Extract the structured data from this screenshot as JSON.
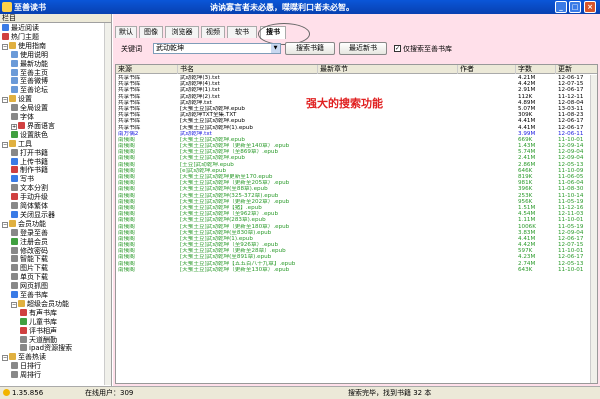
{
  "window": {
    "title": "至善读书",
    "banner": "讷讷寡言者未必愚，喋喋利口者未必智。"
  },
  "left": {
    "header": "栏目"
  },
  "tree": [
    {
      "label": "最近阅读",
      "depth": 0,
      "exp": "",
      "color": "#3a7be6"
    },
    {
      "label": "热门主题",
      "depth": 0,
      "exp": "",
      "color": "#d04040"
    },
    {
      "label": "使用指南",
      "depth": 0,
      "exp": "−",
      "color": "#e0b040"
    },
    {
      "label": "使用说明",
      "depth": 1,
      "exp": "",
      "color": "#6a9ad8"
    },
    {
      "label": "最新功能",
      "depth": 1,
      "exp": "",
      "color": "#6a9ad8"
    },
    {
      "label": "至善主页",
      "depth": 1,
      "exp": "",
      "color": "#6a9ad8"
    },
    {
      "label": "至善微博",
      "depth": 1,
      "exp": "",
      "color": "#6a9ad8"
    },
    {
      "label": "至善论坛",
      "depth": 1,
      "exp": "",
      "color": "#6a9ad8"
    },
    {
      "label": "设置",
      "depth": 0,
      "exp": "−",
      "color": "#e0b040"
    },
    {
      "label": "全局设置",
      "depth": 1,
      "exp": "",
      "color": "#888"
    },
    {
      "label": "字体",
      "depth": 1,
      "exp": "",
      "color": "#888"
    },
    {
      "label": "界面语言",
      "depth": 1,
      "exp": "+",
      "color": "#d04040"
    },
    {
      "label": "设置肤色",
      "depth": 1,
      "exp": "",
      "color": "#40a040"
    },
    {
      "label": "工具",
      "depth": 0,
      "exp": "−",
      "color": "#e0b040"
    },
    {
      "label": "打开书籍",
      "depth": 1,
      "exp": "",
      "color": "#888"
    },
    {
      "label": "上传书籍",
      "depth": 1,
      "exp": "",
      "color": "#3a7be6"
    },
    {
      "label": "制作书籍",
      "depth": 1,
      "exp": "",
      "color": "#d04040"
    },
    {
      "label": "写书",
      "depth": 1,
      "exp": "",
      "color": "#3a7be6"
    },
    {
      "label": "文本分割",
      "depth": 1,
      "exp": "",
      "color": "#888"
    },
    {
      "label": "手动升级",
      "depth": 1,
      "exp": "",
      "color": "#d04040"
    },
    {
      "label": "简体繁体",
      "depth": 1,
      "exp": "",
      "color": "#888"
    },
    {
      "label": "关闭显示器",
      "depth": 1,
      "exp": "",
      "color": "#3a7be6"
    },
    {
      "label": "会员功能",
      "depth": 0,
      "exp": "−",
      "color": "#e0b040"
    },
    {
      "label": "登录至善",
      "depth": 1,
      "exp": "",
      "color": "#888"
    },
    {
      "label": "注册会员",
      "depth": 1,
      "exp": "",
      "color": "#40a040"
    },
    {
      "label": "修改密码",
      "depth": 1,
      "exp": "",
      "color": "#888"
    },
    {
      "label": "智能下载",
      "depth": 1,
      "exp": "",
      "color": "#888"
    },
    {
      "label": "图片下载",
      "depth": 1,
      "exp": "",
      "color": "#888"
    },
    {
      "label": "单页下载",
      "depth": 1,
      "exp": "",
      "color": "#888"
    },
    {
      "label": "网页抓图",
      "depth": 1,
      "exp": "",
      "color": "#888"
    },
    {
      "label": "至善书库",
      "depth": 1,
      "exp": "",
      "color": "#3a7be6"
    },
    {
      "label": "超级会员功能",
      "depth": 1,
      "exp": "−",
      "color": "#e0b040"
    },
    {
      "label": "有声书库",
      "depth": 2,
      "exp": "",
      "color": "#d04040"
    },
    {
      "label": "儿童书库",
      "depth": 2,
      "exp": "",
      "color": "#40a040"
    },
    {
      "label": "评书相声",
      "depth": 2,
      "exp": "",
      "color": "#d04040"
    },
    {
      "label": "天道酬勤",
      "depth": 2,
      "exp": "",
      "color": "#888"
    },
    {
      "label": "ipad资源搜索",
      "depth": 2,
      "exp": "",
      "color": "#888"
    },
    {
      "label": "至善热读",
      "depth": 0,
      "exp": "−",
      "color": "#e0b040"
    },
    {
      "label": "日排行",
      "depth": 1,
      "exp": "",
      "color": "#888"
    },
    {
      "label": "周排行",
      "depth": 1,
      "exp": "",
      "color": "#888"
    }
  ],
  "tabs": [
    "默认",
    "图像",
    "浏览器",
    "视频",
    "软书",
    "搜书"
  ],
  "search": {
    "label": "关键词",
    "value": "武动乾坤",
    "btn_search": "搜索书籍",
    "btn_latest": "最近新书",
    "checkbox_label": "仅搜索至善书库",
    "checkbox_mark": "✓"
  },
  "annotation": "强大的搜索功能",
  "table": {
    "headers": [
      "来源",
      "书名",
      "最新章节",
      "作者",
      "字数",
      "更新"
    ],
    "rows": [
      {
        "src": "共享书库",
        "name": "武动乾坤(3).txt",
        "ch": "",
        "au": "",
        "size": "4.21M",
        "date": "12-06-17",
        "color": "#000"
      },
      {
        "src": "共享书库",
        "name": "武动乾坤(4).txt",
        "ch": "",
        "au": "",
        "size": "4.42M",
        "date": "12-07-15",
        "color": "#000"
      },
      {
        "src": "共享书库",
        "name": "武动乾坤(1).txt",
        "ch": "",
        "au": "",
        "size": "2.91M",
        "date": "12-06-17",
        "color": "#000"
      },
      {
        "src": "共享书库",
        "name": "武动乾坤(2).txt",
        "ch": "",
        "au": "",
        "size": "112K",
        "date": "11-12-11",
        "color": "#000"
      },
      {
        "src": "共享书库",
        "name": "武动乾坤.txt",
        "ch": "",
        "au": "",
        "size": "4.89M",
        "date": "12-08-04",
        "color": "#000"
      },
      {
        "src": "共享书库",
        "name": "[天蚕土豆]武动乾坤.epub",
        "ch": "",
        "au": "",
        "size": "5.07M",
        "date": "13-03-11",
        "color": "#000"
      },
      {
        "src": "共享书库",
        "name": "武动乾坤TXT全集.TXT",
        "ch": "",
        "au": "",
        "size": "309K",
        "date": "11-08-23",
        "color": "#000"
      },
      {
        "src": "共享书库",
        "name": "[天蚕土豆]武动乾坤.epub",
        "ch": "",
        "au": "",
        "size": "4.41M",
        "date": "12-06-17",
        "color": "#000"
      },
      {
        "src": "共享书库",
        "name": "[天蚕土豆]武动乾坤(1).epub",
        "ch": "",
        "au": "",
        "size": "4.41M",
        "date": "12-06-17",
        "color": "#000"
      },
      {
        "src": "南方偶2",
        "name": "武动乾坤.txt",
        "ch": "",
        "au": "",
        "size": "3.99M",
        "date": "12-06-11",
        "color": "#2020e0"
      },
      {
        "src": "南俄阁",
        "name": "[天蚕土豆]武动乾坤.epub",
        "ch": "",
        "au": "",
        "size": "669K",
        "date": "11-10-01",
        "color": "#2a9a2a"
      },
      {
        "src": "南俄阁",
        "name": "[天蚕土豆]武动乾坤（更新至140章）.epub",
        "ch": "",
        "au": "",
        "size": "1.43M",
        "date": "12-09-14",
        "color": "#2a9a2a"
      },
      {
        "src": "南俄阁",
        "name": "[天蚕土豆]武动乾坤（至869章）.epub",
        "ch": "",
        "au": "",
        "size": "5.74M",
        "date": "12-09-04",
        "color": "#2a9a2a"
      },
      {
        "src": "南俄阁",
        "name": "[天蚕土豆]武动乾坤.epub",
        "ch": "",
        "au": "",
        "size": "2.41M",
        "date": "12-09-04",
        "color": "#2a9a2a"
      },
      {
        "src": "南俄阁",
        "name": "[土豆]武动乾坤.epub",
        "ch": "",
        "au": "",
        "size": "2.86M",
        "date": "12-05-13",
        "color": "#2a9a2a"
      },
      {
        "src": "南俄阁",
        "name": "[e]武动乾坤.epub",
        "ch": "",
        "au": "",
        "size": "646K",
        "date": "11-10-09",
        "color": "#2a9a2a"
      },
      {
        "src": "南俄阁",
        "name": "[天蚕土豆]武动乾坤更新至170.epub",
        "ch": "",
        "au": "",
        "size": "819K",
        "date": "11-06-05",
        "color": "#2a9a2a"
      },
      {
        "src": "南俄阁",
        "name": "[天蚕土豆]武动乾坤（更新至205章）.epub",
        "ch": "",
        "au": "",
        "size": "981K",
        "date": "11-06-04",
        "color": "#2a9a2a"
      },
      {
        "src": "南俄阁",
        "name": "[天蚕土豆]武动乾坤(至88章).epub",
        "ch": "",
        "au": "",
        "size": "396K",
        "date": "11-08-30",
        "color": "#2a9a2a"
      },
      {
        "src": "南俄阁",
        "name": "[天蚕土豆]武动乾坤(325-372章).epub",
        "ch": "",
        "au": "",
        "size": "253K",
        "date": "11-10-14",
        "color": "#2a9a2a"
      },
      {
        "src": "南俄阁",
        "name": "[天蚕土豆]武动乾坤（更新至202章）.epub",
        "ch": "",
        "au": "",
        "size": "956K",
        "date": "11-05-19",
        "color": "#2a9a2a"
      },
      {
        "src": "南俄阁",
        "name": "[天蚕土豆]武动乾坤【猪】.epub",
        "ch": "",
        "au": "",
        "size": "1.51M",
        "date": "11-12-16",
        "color": "#2a9a2a"
      },
      {
        "src": "南俄阁",
        "name": "[天蚕土豆]武动乾坤（至962章）.epub",
        "ch": "",
        "au": "",
        "size": "4.54M",
        "date": "12-11-03",
        "color": "#2a9a2a"
      },
      {
        "src": "南俄阁",
        "name": "[天蚕土豆]武动乾坤(283章).epub",
        "ch": "",
        "au": "",
        "size": "1.11M",
        "date": "11-10-01",
        "color": "#2a9a2a"
      },
      {
        "src": "南俄阁",
        "name": "[天蚕土豆]武动乾坤（更新至180章）.epub",
        "ch": "",
        "au": "",
        "size": "1006K",
        "date": "11-05-19",
        "color": "#2a9a2a"
      },
      {
        "src": "南俄阁",
        "name": "[天蚕土豆]武动乾坤(至830章).epub",
        "ch": "",
        "au": "",
        "size": "3.83M",
        "date": "12-09-04",
        "color": "#2a9a2a"
      },
      {
        "src": "南俄阁",
        "name": "[天蚕土豆]武动乾坤(1).epub",
        "ch": "",
        "au": "",
        "size": "4.41M",
        "date": "12-06-17",
        "color": "#2a9a2a"
      },
      {
        "src": "南俄阁",
        "name": "[天蚕土豆]武动乾坤（至926章）.epub",
        "ch": "",
        "au": "",
        "size": "4.42M",
        "date": "12-07-15",
        "color": "#2a9a2a"
      },
      {
        "src": "南俄阁",
        "name": "[天蚕土豆]武动乾坤（更新至28章）.epub",
        "ch": "",
        "au": "",
        "size": "597K",
        "date": "11-10-01",
        "color": "#2a9a2a"
      },
      {
        "src": "南俄阁",
        "name": "[天蚕土豆]武动乾坤(至891章).epub",
        "ch": "",
        "au": "",
        "size": "4.23M",
        "date": "12-06-17",
        "color": "#2a9a2a"
      },
      {
        "src": "南俄阁",
        "name": "[天蚕土豆]武动乾坤【五五百八十九章】.epub",
        "ch": "",
        "au": "",
        "size": "2.74M",
        "date": "12-05-13",
        "color": "#2a9a2a"
      },
      {
        "src": "南俄阁",
        "name": "[天蚕土豆]武动乾坤（更新至130章）.epub",
        "ch": "",
        "au": "",
        "size": "643K",
        "date": "11-10-01",
        "color": "#2a9a2a"
      }
    ]
  },
  "status": {
    "version": "1.35.856",
    "online": "在线用户：309",
    "result": "搜索完毕，找到书籍 32 本"
  }
}
